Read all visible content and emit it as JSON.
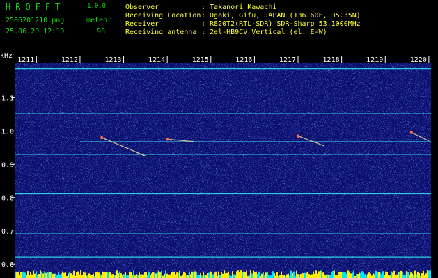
{
  "header": {
    "app_title": "HROFFT",
    "app_version": "1.0.0",
    "file_name": "2506201210.png",
    "timestamp": "25.06.20 12:10",
    "meteor_label": "meteor",
    "meteor_count": "98",
    "observer_label": "Observer",
    "observer_value": ": Takanori Kawachi",
    "location_label": "Receiving Location",
    "location_value": ": Ogaki, Gifu, JAPAN (136.60E, 35.35N)",
    "receiver_label": "Receiver",
    "receiver_value": ": R820T2(RTL-SDR) SDR-Sharp 53.1000MHz",
    "antenna_label": "Receiving antenna",
    "antenna_value": ": 2el-HB9CV Vertical (el. E-W)"
  },
  "colors": {
    "background": "#000000",
    "header_green": "#17d817",
    "header_yellow": "#ffff33",
    "spectrogram_base": "#0a0f6e",
    "carrier_line": "#35e0f0",
    "activity_bar": "#ffee00",
    "activity_cyan": "#00e5ff"
  },
  "chart_data": {
    "type": "heatmap",
    "ylabel": "kHz",
    "x_ticks": [
      "1211",
      "1212",
      "1213",
      "1214",
      "1215",
      "1216",
      "1217",
      "1218",
      "1219",
      "1220"
    ],
    "y_ticks": [
      "1.1",
      "1.0",
      "0.9",
      "0.8",
      "0.7",
      "0.6"
    ],
    "x_range": [
      1210.5,
      1220.05
    ],
    "y_range": [
      0.59,
      1.205
    ],
    "carrier_lines_khz": [
      1.187,
      1.053,
      0.93,
      0.812,
      0.692,
      0.621
    ],
    "meteor_reference_line_khz": 0.968,
    "meteor_echoes": [
      {
        "minute": 1212.5,
        "khz_start": 0.98,
        "minute_end": 1213.5,
        "khz_end": 0.925
      },
      {
        "minute": 1214.0,
        "khz_start": 0.975,
        "minute_end": 1214.6,
        "khz_end": 0.968
      },
      {
        "minute": 1217.0,
        "khz_start": 0.985,
        "minute_end": 1217.6,
        "khz_end": 0.955
      },
      {
        "minute": 1219.6,
        "khz_start": 0.995,
        "minute_end": 1220.0,
        "khz_end": 0.97
      }
    ]
  }
}
